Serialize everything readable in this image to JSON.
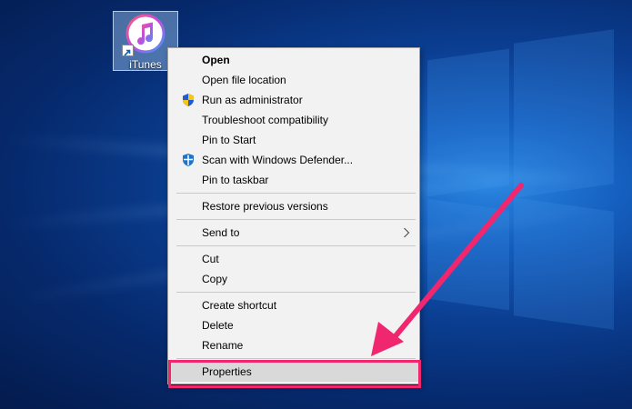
{
  "desktop": {
    "icon": {
      "label": "iTunes",
      "icon": "itunes-icon"
    }
  },
  "context_menu": {
    "items": [
      {
        "label": "Open",
        "bold": true
      },
      {
        "label": "Open file location"
      },
      {
        "label": "Run as administrator",
        "icon": "shield-icon"
      },
      {
        "label": "Troubleshoot compatibility"
      },
      {
        "label": "Pin to Start"
      },
      {
        "label": "Scan with Windows Defender...",
        "icon": "windows-defender-icon"
      },
      {
        "label": "Pin to taskbar"
      },
      {
        "label": "Restore previous versions"
      },
      {
        "label": "Send to",
        "submenu": true
      },
      {
        "label": "Cut"
      },
      {
        "label": "Copy"
      },
      {
        "label": "Create shortcut"
      },
      {
        "label": "Delete"
      },
      {
        "label": "Rename"
      },
      {
        "label": "Properties",
        "highlighted": true
      }
    ]
  },
  "annotation": {
    "arrow_color": "#f0266e",
    "highlight_color": "#f0266e"
  },
  "colors": {
    "menu_bg": "#f2f2f2",
    "menu_border": "#a0a0a0",
    "highlight_row": "#d9d9d9",
    "desktop_blue": "#0b3f93"
  }
}
